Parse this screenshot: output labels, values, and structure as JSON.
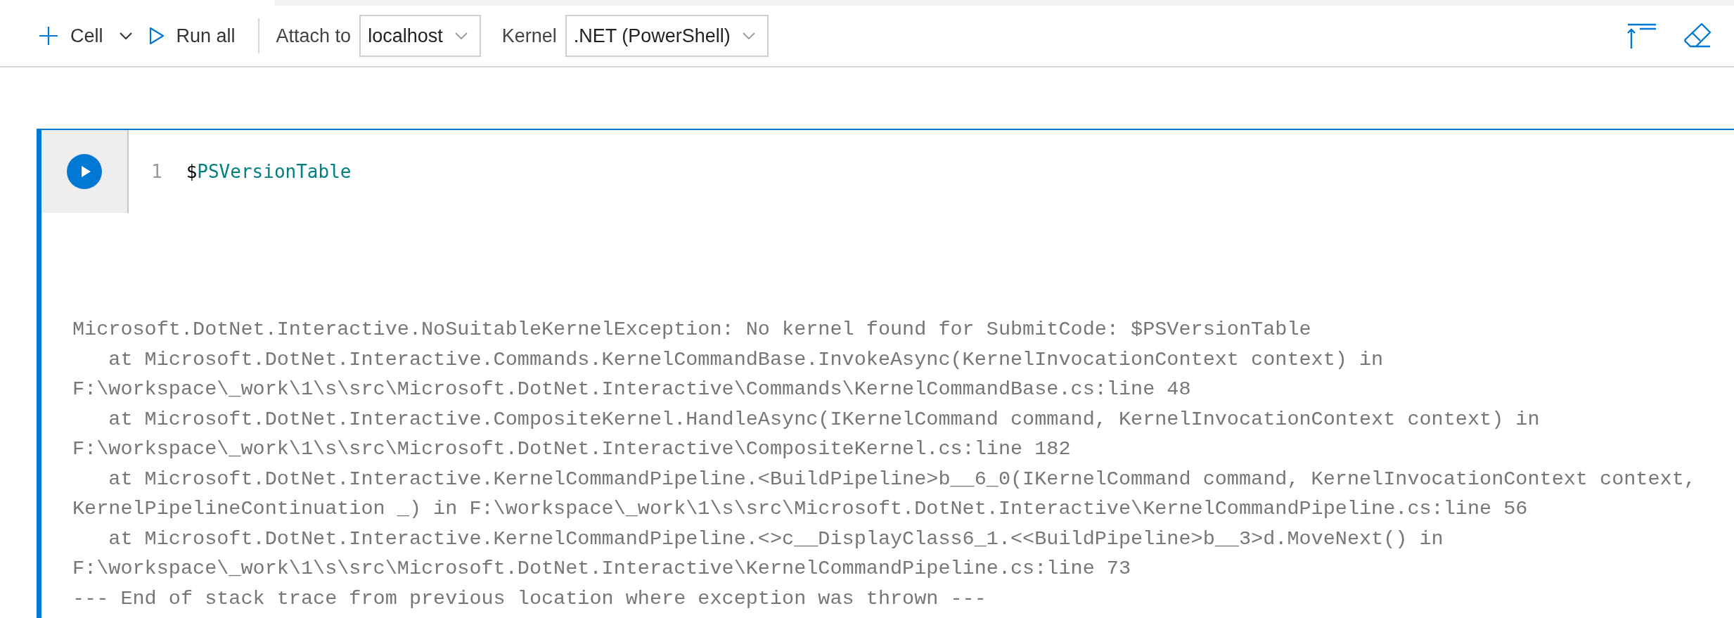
{
  "toolbar": {
    "buttons": [
      {
        "kind": "add",
        "label": "Cell",
        "dropdown": true
      },
      {
        "kind": "run",
        "label": "Run all",
        "dropdown": false
      }
    ],
    "selectors": [
      {
        "label": "Attach to",
        "value": "localhost"
      },
      {
        "label": "Kernel",
        "value": ".NET (PowerShell)"
      }
    ],
    "actions": [
      {
        "kind": "collapse"
      },
      {
        "kind": "clear"
      }
    ]
  },
  "cell": {
    "selected": true,
    "line_number": "1",
    "code": [
      {
        "kind": "plain",
        "text": "$"
      },
      {
        "kind": "variable",
        "text": "PSVersionTable"
      }
    ],
    "output": [
      "Microsoft.DotNet.Interactive.NoSuitableKernelException: No kernel found for SubmitCode: $PSVersionTable",
      "   at Microsoft.DotNet.Interactive.Commands.KernelCommandBase.InvokeAsync(KernelInvocationContext context) in",
      "F:\\workspace\\_work\\1\\s\\src\\Microsoft.DotNet.Interactive\\Commands\\KernelCommandBase.cs:line 48",
      "   at Microsoft.DotNet.Interactive.CompositeKernel.HandleAsync(IKernelCommand command, KernelInvocationContext context) in",
      "F:\\workspace\\_work\\1\\s\\src\\Microsoft.DotNet.Interactive\\CompositeKernel.cs:line 182",
      "   at Microsoft.DotNet.Interactive.KernelCommandPipeline.<BuildPipeline>b__6_0(IKernelCommand command, KernelInvocationContext context,",
      "KernelPipelineContinuation _) in F:\\workspace\\_work\\1\\s\\src\\Microsoft.DotNet.Interactive\\KernelCommandPipeline.cs:line 56",
      "   at Microsoft.DotNet.Interactive.KernelCommandPipeline.<>c__DisplayClass6_1.<<BuildPipeline>b__3>d.MoveNext() in",
      "F:\\workspace\\_work\\1\\s\\src\\Microsoft.DotNet.Interactive\\KernelCommandPipeline.cs:line 73",
      "--- End of stack trace from previous location where exception was thrown ---"
    ]
  }
}
